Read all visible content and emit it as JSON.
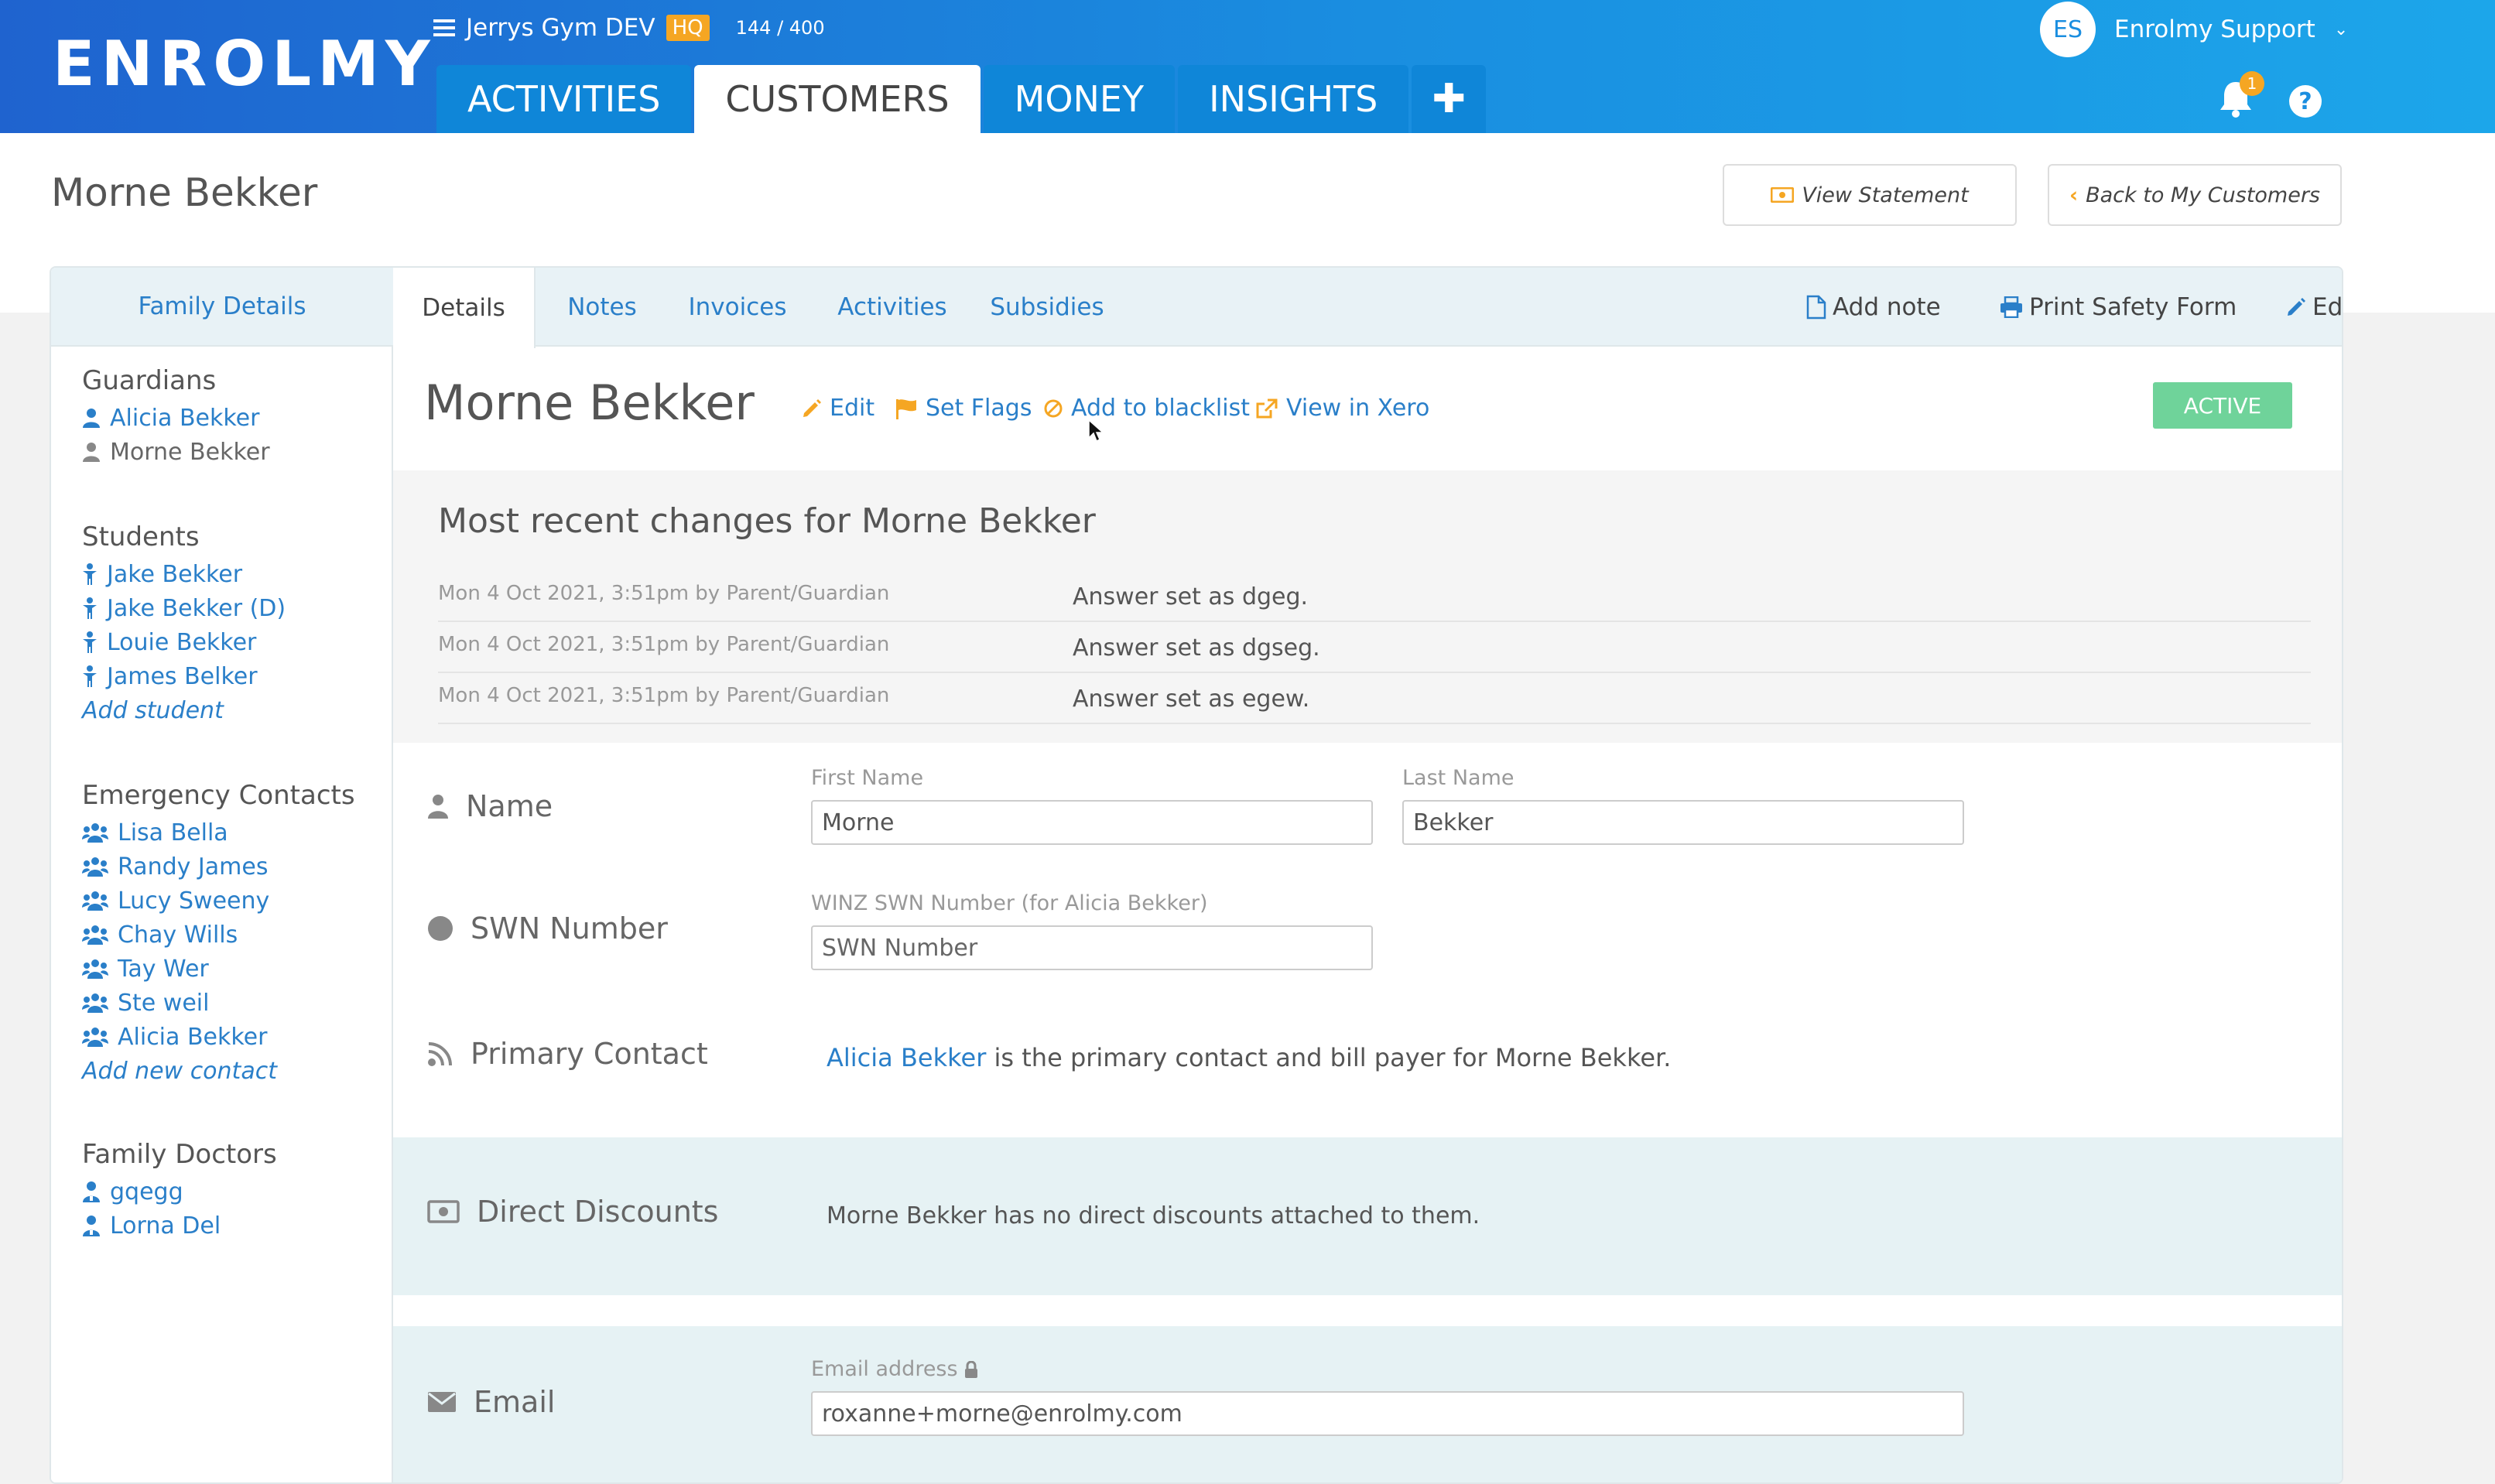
{
  "header": {
    "logo": "ENROLMY",
    "gym_name": "Jerrys Gym DEV",
    "hq_badge": "HQ",
    "quota": "144 / 400",
    "tabs": [
      {
        "label": "ACTIVITIES"
      },
      {
        "label": "CUSTOMERS"
      },
      {
        "label": "MONEY"
      },
      {
        "label": "INSIGHTS"
      },
      {
        "label": "✚"
      }
    ],
    "user_initials": "ES",
    "user_name": "Enrolmy Support",
    "notification_count": "1",
    "help": "?"
  },
  "page": {
    "title": "Morne Bekker",
    "view_statement": "View Statement",
    "back": "Back to My Customers"
  },
  "sidebar": {
    "tab": "Family Details",
    "guardians_title": "Guardians",
    "guardians": [
      "Alicia Bekker",
      "Morne Bekker"
    ],
    "students_title": "Students",
    "students": [
      "Jake Bekker",
      "Jake Bekker (D)",
      "Louie Bekker",
      "James Belker"
    ],
    "add_student": "Add student",
    "emergency_title": "Emergency Contacts",
    "emergency": [
      "Lisa Bella",
      "Randy James",
      "Lucy Sweeny",
      "Chay Wills",
      "Tay Wer",
      "Ste weil",
      "Alicia Bekker"
    ],
    "add_contact": "Add new contact",
    "doctors_title": "Family Doctors",
    "doctors": [
      "gqegg",
      "Lorna Del"
    ]
  },
  "detail_tabs": [
    "Details",
    "Notes",
    "Invoices",
    "Activities",
    "Subsidies"
  ],
  "actions": {
    "add_note": "Add note",
    "print": "Print Safety Form",
    "edit": "Edit"
  },
  "profile": {
    "name": "Morne Bekker",
    "edit": "Edit",
    "set_flags": "Set Flags",
    "blacklist": "Add to blacklist",
    "xero": "View in Xero",
    "status": "ACTIVE"
  },
  "recent": {
    "title": "Most recent changes for Morne Bekker",
    "rows": [
      {
        "when": "Mon 4 Oct 2021, 3:51pm by Parent/Guardian",
        "what": "Answer set as dgeg."
      },
      {
        "when": "Mon 4 Oct 2021, 3:51pm by Parent/Guardian",
        "what": "Answer set as dgseg."
      },
      {
        "when": "Mon 4 Oct 2021, 3:51pm by Parent/Guardian",
        "what": "Answer set as egew."
      }
    ]
  },
  "fields": {
    "name_label": "Name",
    "first_name_label": "First Name",
    "first_name": "Morne",
    "last_name_label": "Last Name",
    "last_name": "Bekker",
    "swn_label": "SWN Number",
    "swn_field_label": "WINZ SWN Number (for Alicia Bekker)",
    "swn_placeholder": "SWN Number",
    "primary_label": "Primary Contact",
    "primary_link": "Alicia Bekker",
    "primary_text": " is the primary contact and bill payer for Morne Bekker.",
    "discounts_label": "Direct Discounts",
    "discounts_text": "Morne Bekker has no direct discounts attached to them.",
    "email_label": "Email",
    "email_field_label": "Email address",
    "email": "roxanne+morne@enrolmy.com"
  },
  "colors": {
    "brand_blue": "#1a8ee0",
    "link": "#2a7fc9",
    "accent_orange": "#f5a623",
    "active_green": "#6fd39a"
  }
}
